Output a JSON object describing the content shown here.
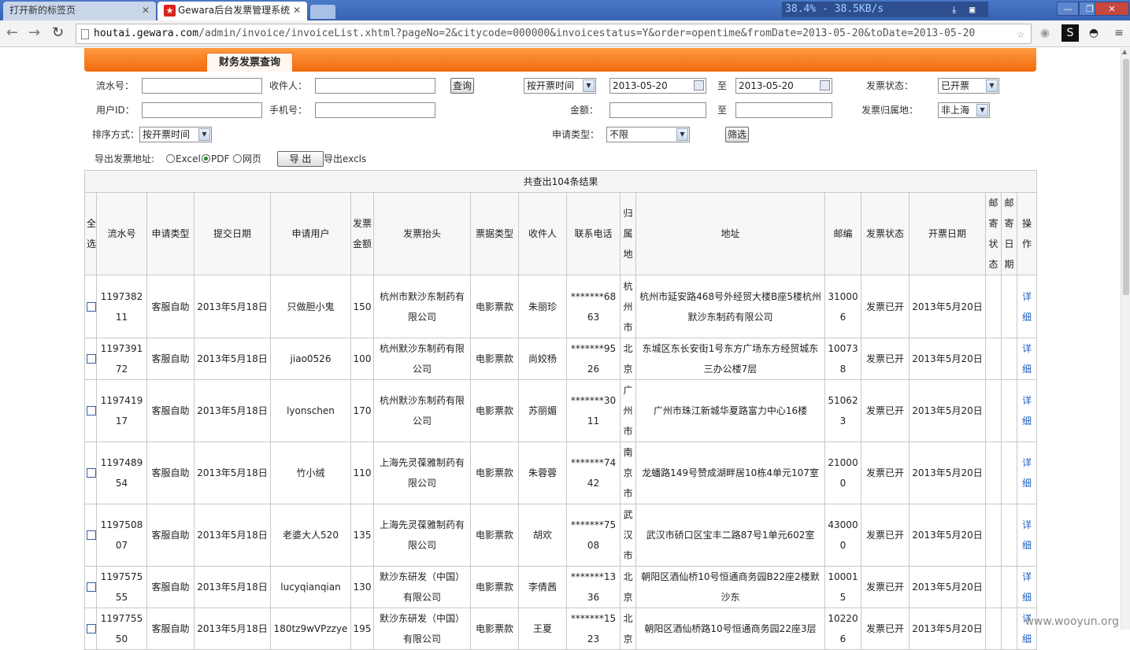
{
  "browser": {
    "tabs": [
      {
        "title": "打开新的标签页"
      },
      {
        "title": "Gewara后台发票管理系统"
      }
    ],
    "speed": "38.4% - 38.5KB/s",
    "url_host": "houtai.gewara.com",
    "url_path": "/admin/invoice/invoiceList.xhtml?pageNo=2&citycode=000000&invoicestatus=Y&order=opentime&fromDate=2013-05-20&toDate=2013-05-20"
  },
  "header": {
    "title": "财务发票查询"
  },
  "filters": {
    "serial_label": "流水号：",
    "recipient_label": "收件人：",
    "query_button": "查询",
    "sort_time_select": "按开票时间",
    "from_date": "2013-05-20",
    "to_label": "至",
    "to_date": "2013-05-20",
    "status_label": "发票状态：",
    "status_value": "已开票",
    "userid_label": "用户ID：",
    "phone_label": "手机号：",
    "amount_label": "金额：",
    "amount_to_label": "至",
    "region_label": "发票归属地：",
    "region_value": "非上海",
    "sort_label": "排序方式：",
    "sort_value": "按开票时间",
    "apply_type_label": "申请类型：",
    "apply_type_value": "不限",
    "filter_button": "筛选",
    "export_label": "导出发票地址:",
    "export_opt_excel": "Excel",
    "export_opt_pdf": "PDF",
    "export_opt_web": "网页",
    "export_button": "导 出",
    "export_excls": "导出excls"
  },
  "table": {
    "count_text": "共查出104条结果",
    "headers": [
      "全选",
      "流水号",
      "申请类型",
      "提交日期",
      "申请用户",
      "发票金额",
      "发票抬头",
      "票据类型",
      "收件人",
      "联系电话",
      "归属地",
      "地址",
      "邮编",
      "发票状态",
      "开票日期",
      "邮寄状态",
      "邮寄日期",
      "操作"
    ],
    "rows": [
      [
        "",
        "119738211",
        "客服自助",
        "2013年5月18日",
        "只做胆小鬼",
        "150",
        "杭州市默沙东制药有限公司",
        "电影票款",
        "朱丽珍",
        "*******6863",
        "杭州市",
        "杭州市延安路468号外经贸大楼B座5楼杭州默沙东制药有限公司",
        "310006",
        "发票已开",
        "2013年5月20日",
        "",
        "",
        "详细"
      ],
      [
        "",
        "119739172",
        "客服自助",
        "2013年5月18日",
        "jiao0526",
        "100",
        "杭州默沙东制药有限公司",
        "电影票款",
        "尚姣杨",
        "*******9526",
        "北京",
        "东城区东长安街1号东方广场东方经贸城东三办公楼7层",
        "100738",
        "发票已开",
        "2013年5月20日",
        "",
        "",
        "详细"
      ],
      [
        "",
        "119741917",
        "客服自助",
        "2013年5月18日",
        "lyonschen",
        "170",
        "杭州默沙东制药有限公司",
        "电影票款",
        "苏丽媚",
        "*******3011",
        "广州市",
        "广州市珠江新城华夏路富力中心16楼",
        "510623",
        "发票已开",
        "2013年5月20日",
        "",
        "",
        "详细"
      ],
      [
        "",
        "119748954",
        "客服自助",
        "2013年5月18日",
        "竹小绒",
        "110",
        "上海先灵葆雅制药有限公司",
        "电影票款",
        "朱蓉蓉",
        "*******7442",
        "南京市",
        "龙蟠路149号赞成湖畔居10栋4单元107室",
        "210000",
        "发票已开",
        "2013年5月20日",
        "",
        "",
        "详细"
      ],
      [
        "",
        "119750807",
        "客服自助",
        "2013年5月18日",
        "老婆大人520",
        "135",
        "上海先灵葆雅制药有限公司",
        "电影票款",
        "胡欢",
        "*******7508",
        "武汉市",
        "武汉市硚口区宝丰二路87号1单元602室",
        "430000",
        "发票已开",
        "2013年5月20日",
        "",
        "",
        "详细"
      ],
      [
        "",
        "119757555",
        "客服自助",
        "2013年5月18日",
        "lucyqianqian",
        "130",
        "默沙东研发（中国）有限公司",
        "电影票款",
        "李倩茜",
        "*******1336",
        "北京",
        "朝阳区酒仙桥10号恒通商务园B22座2楼默沙东",
        "100015",
        "发票已开",
        "2013年5月20日",
        "",
        "",
        "详细"
      ],
      [
        "",
        "119775550",
        "客服自助",
        "2013年5月18日",
        "180tz9wVPzzye",
        "195",
        "默沙东研发（中国）有限公司",
        "电影票款",
        "王夏",
        "*******1523",
        "北京",
        "朝阳区酒仙桥路10号恒通商务园22座3层",
        "102206",
        "发票已开",
        "2013年5月20日",
        "",
        "",
        "详细"
      ]
    ]
  },
  "watermark": "www.wooyun.org"
}
